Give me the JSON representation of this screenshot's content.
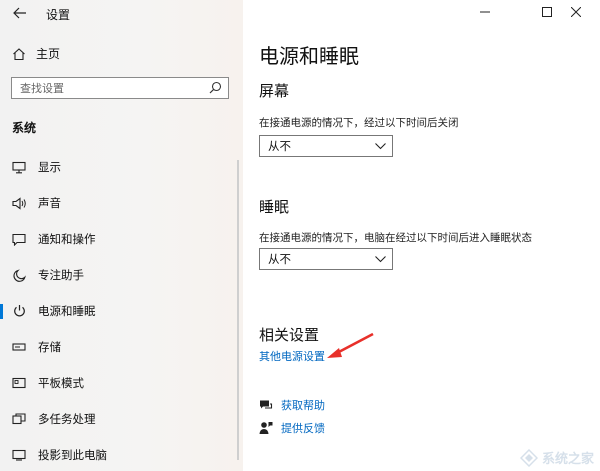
{
  "window": {
    "title": "设置",
    "controls": [
      "minimize",
      "maximize",
      "close"
    ]
  },
  "sidebar": {
    "home_label": "主页",
    "search_placeholder": "查找设置",
    "section_title": "系统",
    "items": [
      {
        "label": "显示",
        "icon": "monitor-icon",
        "active": false
      },
      {
        "label": "声音",
        "icon": "speaker-icon",
        "active": false
      },
      {
        "label": "通知和操作",
        "icon": "message-icon",
        "active": false
      },
      {
        "label": "专注助手",
        "icon": "moon-icon",
        "active": false
      },
      {
        "label": "电源和睡眠",
        "icon": "power-icon",
        "active": true
      },
      {
        "label": "存储",
        "icon": "storage-icon",
        "active": false
      },
      {
        "label": "平板模式",
        "icon": "tablet-icon",
        "active": false
      },
      {
        "label": "多任务处理",
        "icon": "multitask-icon",
        "active": false
      },
      {
        "label": "投影到此电脑",
        "icon": "project-icon",
        "active": false
      }
    ]
  },
  "main": {
    "page_title": "电源和睡眠",
    "screen": {
      "heading": "屏幕",
      "description": "在接通电源的情况下，经过以下时间后关闭",
      "selected": "从不"
    },
    "sleep": {
      "heading": "睡眠",
      "description": "在接通电源的情况下，电脑在经过以下时间后进入睡眠状态",
      "selected": "从不"
    },
    "related": {
      "heading": "相关设置",
      "link": "其他电源设置"
    },
    "help": [
      {
        "label": "获取帮助",
        "icon": "help-chat-icon"
      },
      {
        "label": "提供反馈",
        "icon": "feedback-icon"
      }
    ]
  },
  "annotation": {
    "arrow_color": "#e8302a"
  },
  "watermark": {
    "text": "系统之家"
  }
}
